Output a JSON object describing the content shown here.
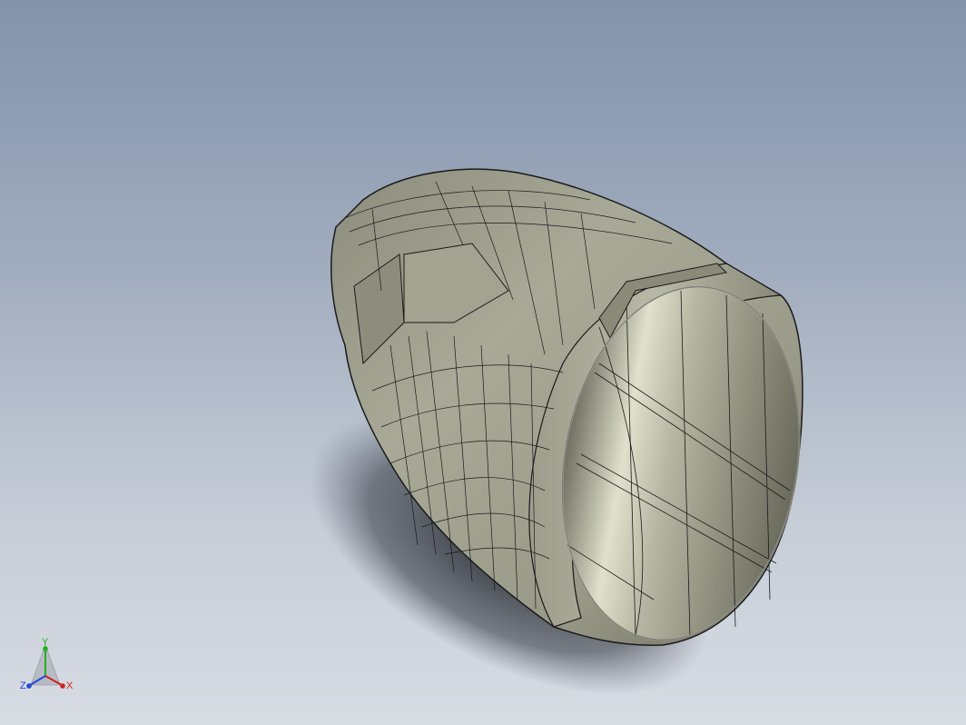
{
  "viewport": {
    "background_top": "#8393aa",
    "background_bottom": "#d8dce3"
  },
  "model": {
    "part_color": "#a8a897",
    "edge_color": "#1a1a1a",
    "shadow_color": "#2b2f36"
  },
  "triad": {
    "x_label": "X",
    "y_label": "Y",
    "z_label": "Z",
    "x_color": "#d21e1e",
    "y_color": "#22b022",
    "z_color": "#2346d8"
  }
}
